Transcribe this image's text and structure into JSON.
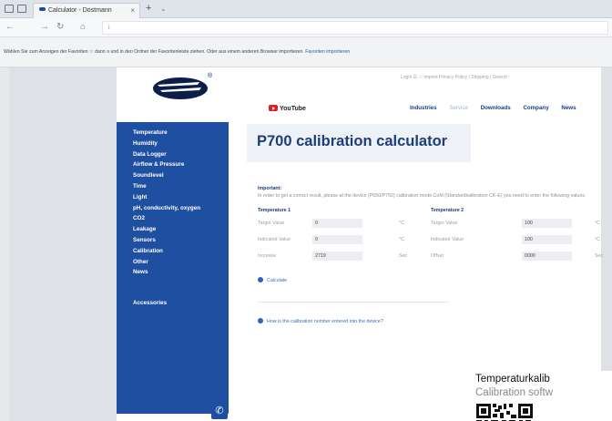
{
  "browser": {
    "tab_title": "Calculator - Dostmann",
    "tab_close": "×",
    "new_tab": "+",
    "tab_menu": "⌄",
    "nav_back": "←",
    "nav_forward": "→",
    "nav_reload": "↻",
    "nav_home": "⌂",
    "address": "i",
    "favorites_bar_text": "Wählen Sie zum Anzeigen der Favoriten ☆ dann ≡ und in den Ordner der Favoritenleiste ziehen. Oder aus einem anderen Browser importieren.",
    "favorites_import_link": "Favoriten importieren"
  },
  "site": {
    "logo_mark": "®",
    "top_meta": "Login  ☰   ☆   Imprint   Privacy Policy   |   Shipping   |   Search",
    "youtube_label": "YouTube",
    "main_nav": [
      "Industries",
      "Service",
      "Downloads",
      "Company",
      "News"
    ],
    "active_nav_index": 1,
    "sidemenu": [
      "Temperature",
      "Humidity",
      "Data Logger",
      "Airflow & Pressure",
      "Soundlevel",
      "Time",
      "Light",
      "pH, conductivity, oxygen",
      "CO2",
      "Leakage",
      "Sensors",
      "Calibration",
      "Other",
      "News"
    ],
    "sidemenu_extra": "Accessories",
    "phone_icon": "✆"
  },
  "calculator": {
    "title": "P700 calibration calculator",
    "important_label": "Important:",
    "important_text": "In order to get a correct result, please at the device (P650/P750) calibration mode CoM (Standardkalibration CK-E) you need to enter the following values.",
    "columns": [
      {
        "heading": "Temperature 1",
        "rows": [
          {
            "label": "Target Value",
            "value": "0",
            "unit": "°C"
          },
          {
            "label": "Indicated Value",
            "value": "0",
            "unit": "°C"
          },
          {
            "label": "Increase",
            "value": "2719",
            "unit": "Sec"
          }
        ]
      },
      {
        "heading": "Temperature 2",
        "rows": [
          {
            "label": "Target Value",
            "value": "100",
            "unit": "°C"
          },
          {
            "label": "Indicated Value",
            "value": "100",
            "unit": "°C"
          },
          {
            "label": "Offset",
            "value": "0000",
            "unit": "Sec"
          }
        ]
      }
    ],
    "calculate_label": "Calculate",
    "faq_text": "How is the calibration number entered into the device?"
  },
  "overlay": {
    "title": "Temperaturkalib",
    "subtitle": "Calibration softw"
  },
  "colors": {
    "brand_blue": "#1e4fa1",
    "title_blue": "#1b3e78",
    "youtube_red": "#e02020"
  }
}
